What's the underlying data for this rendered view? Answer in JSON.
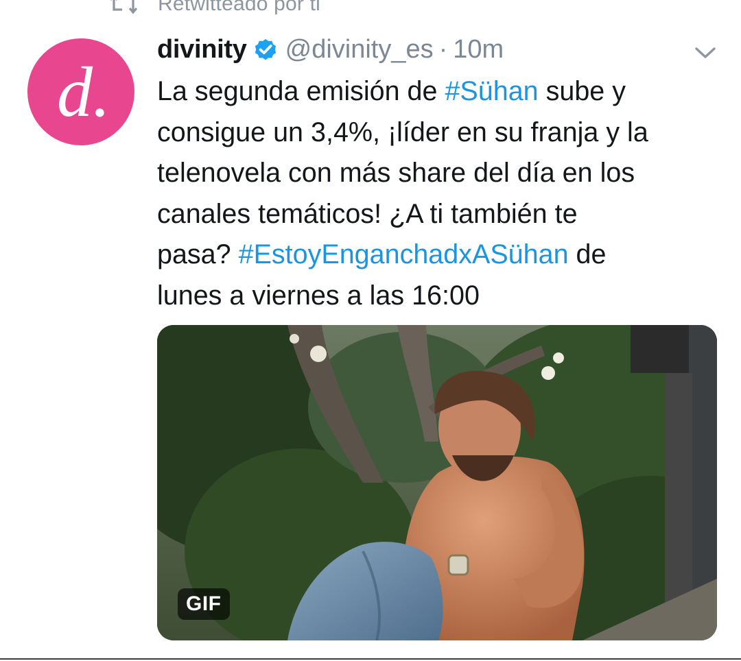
{
  "retweet_header": {
    "text": "Retwitteado por ti",
    "icon": "retweet-icon"
  },
  "tweet": {
    "avatar_letter": "d.",
    "display_name": "divinity",
    "verified_icon": "verified-badge-icon",
    "handle": "@divinity_es",
    "separator": "·",
    "time": "10m",
    "menu_icon": "chevron-down-icon",
    "text_lines": [
      [
        {
          "t": "La segunda emisión de "
        },
        {
          "t": "#Sühan",
          "tag": true
        },
        {
          "t": " sube y"
        }
      ],
      [
        {
          "t": "consigue un 3,4%, ¡líder en su franja y la"
        }
      ],
      [
        {
          "t": "telenovela con más share del día en los"
        }
      ],
      [
        {
          "t": "canales temáticos! ¿A ti también te"
        }
      ],
      [
        {
          "t": "pasa? "
        },
        {
          "t": "#EstoyEnganchadxASühan",
          "tag": true
        },
        {
          "t": " de"
        }
      ],
      [
        {
          "t": "lunes a viernes a las 16:00"
        }
      ]
    ],
    "media": {
      "type": "gif",
      "badge": "GIF"
    }
  },
  "colors": {
    "avatar_bg": "#e8478f",
    "hashtag": "#1b95e0",
    "verified": "#1da1f2",
    "muted": "#7b8793"
  }
}
